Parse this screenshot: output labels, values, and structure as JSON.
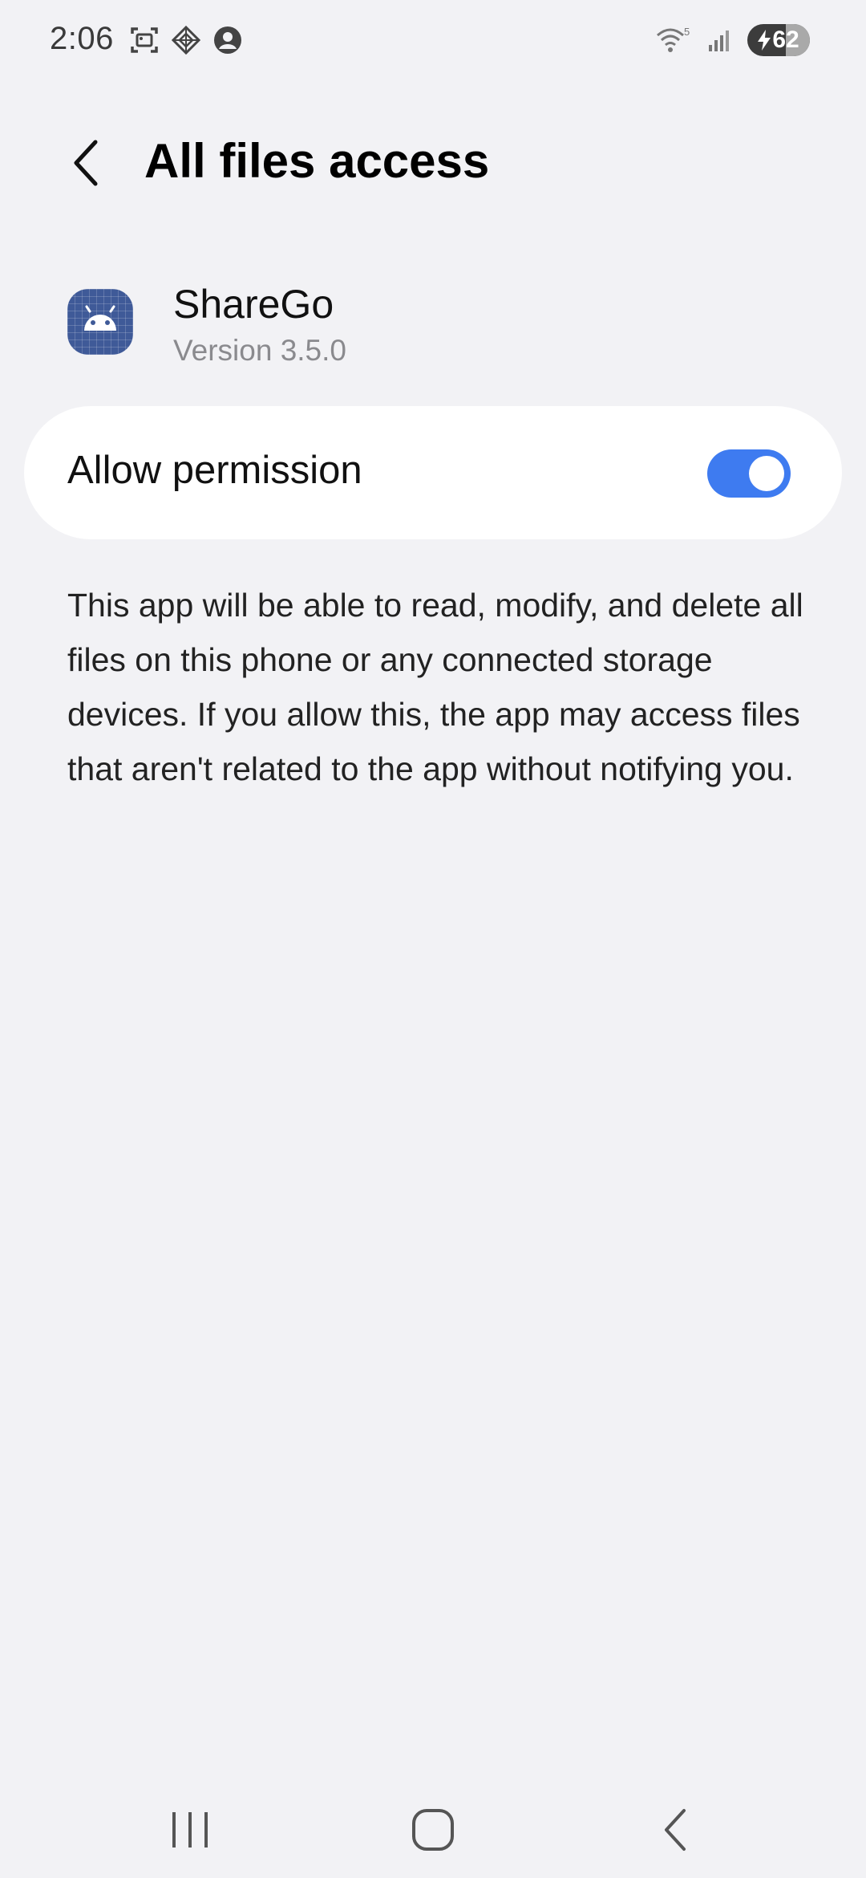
{
  "status_bar": {
    "time": "2:06",
    "left_icons": [
      "screenshot-icon",
      "vpn-diamond-icon",
      "account-icon"
    ],
    "right_icons": [
      "wifi-icon",
      "signal-icon"
    ],
    "wifi_label": "5",
    "battery_level": "62",
    "charging": true
  },
  "header": {
    "back_icon": "chevron-left-icon",
    "title": "All files access"
  },
  "app": {
    "icon": "android-icon",
    "name": "ShareGo",
    "version": "Version 3.5.0",
    "icon_color": "#3f5a98"
  },
  "permission": {
    "label": "Allow permission",
    "enabled": true,
    "toggle_color": "#3e7bf0"
  },
  "description": "This app will be able to read, modify, and delete all files on this phone or any connected storage devices. If you allow this, the app may access files that aren't related to the app without notifying you.",
  "nav_bar": {
    "buttons": [
      "recents-icon",
      "home-icon",
      "back-icon"
    ]
  }
}
